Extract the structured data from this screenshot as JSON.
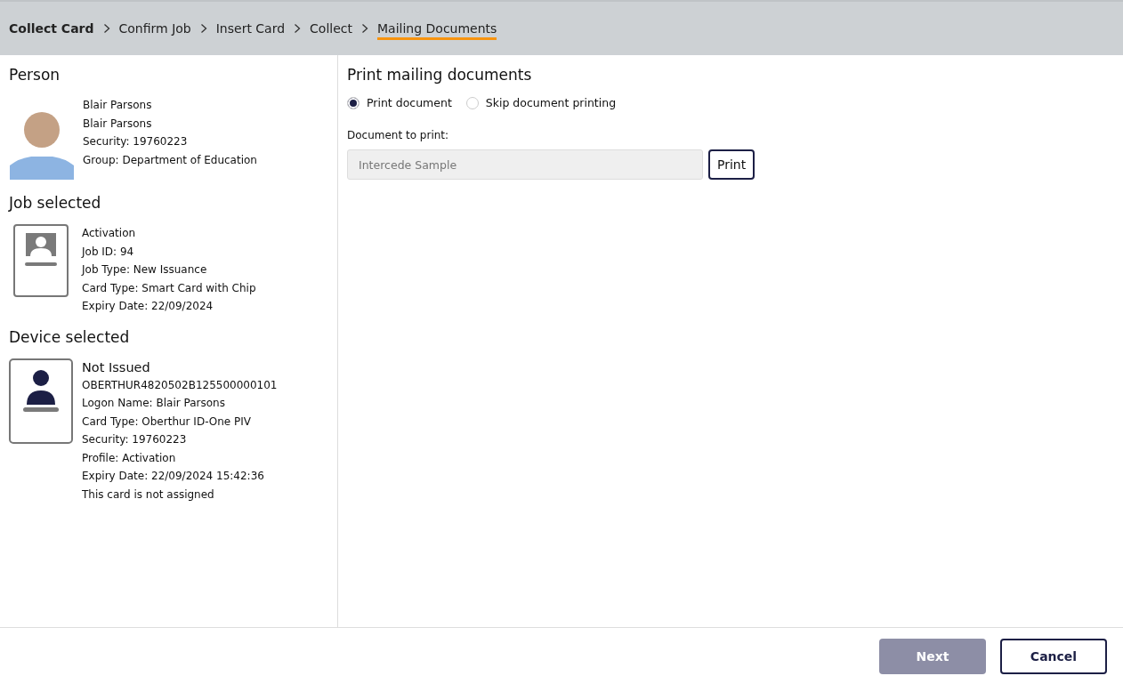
{
  "breadcrumb": [
    {
      "label": "Collect Card",
      "bold": true,
      "selected": false
    },
    {
      "label": "Confirm Job",
      "bold": false,
      "selected": false
    },
    {
      "label": "Insert Card",
      "bold": false,
      "selected": false
    },
    {
      "label": "Collect",
      "bold": false,
      "selected": false
    },
    {
      "label": "Mailing Documents",
      "bold": false,
      "selected": true
    }
  ],
  "person": {
    "heading": "Person",
    "lines": [
      "Blair Parsons",
      "Blair Parsons",
      "Security: 19760223",
      "Group: Department of Education"
    ]
  },
  "job": {
    "heading": "Job selected",
    "lines": [
      "Activation",
      "Job ID: 94",
      "Job Type: New Issuance",
      "Card Type: Smart Card with Chip",
      "Expiry Date: 22/09/2024"
    ]
  },
  "device": {
    "heading": "Device selected",
    "title": "Not Issued",
    "lines": [
      "OBERTHUR4820502B125500000101",
      "Logon Name: Blair Parsons",
      "Card Type: Oberthur ID-One PIV",
      "Security: 19760223",
      "Profile: Activation",
      "Expiry Date: 22/09/2024 15:42:36",
      "This card is not assigned"
    ]
  },
  "main": {
    "heading": "Print mailing documents",
    "options": [
      {
        "label": "Print document",
        "selected": true
      },
      {
        "label": "Skip document printing",
        "selected": false
      }
    ],
    "document_label": "Document to print:",
    "document_value": "Intercede Sample",
    "document_disabled": true,
    "print_button": "Print"
  },
  "footer": {
    "buttons": [
      {
        "label": "Next",
        "kind": "primary",
        "disabled": true
      },
      {
        "label": "Cancel",
        "kind": "secondary",
        "disabled": false
      }
    ]
  }
}
